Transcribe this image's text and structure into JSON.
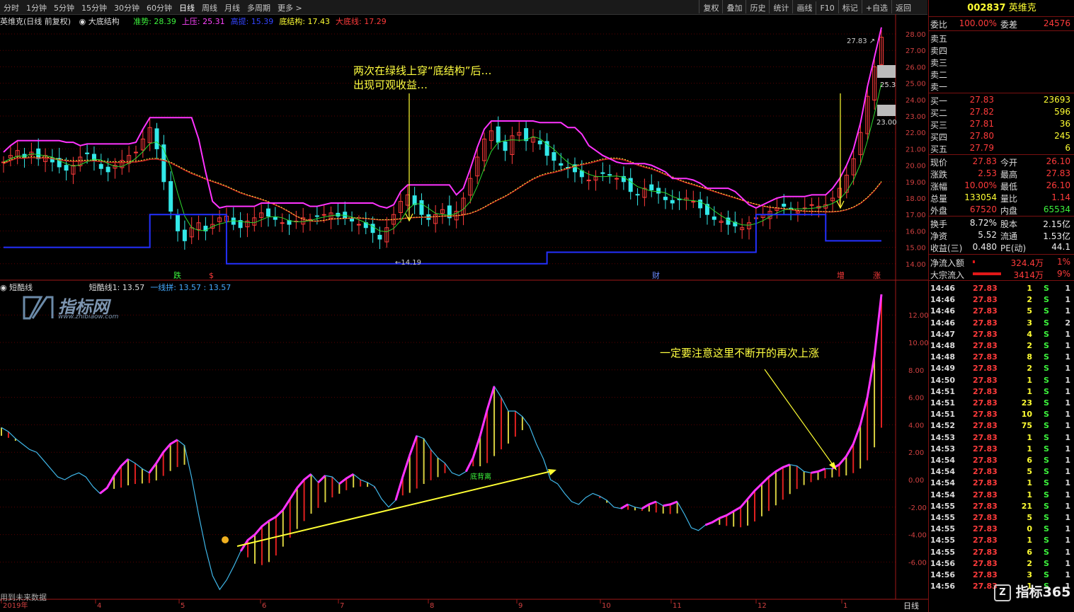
{
  "toolbar": {
    "left_items": [
      "分时",
      "1分钟",
      "5分钟",
      "15分钟",
      "30分钟",
      "60分钟",
      "日线",
      "周线",
      "月线",
      "多周期",
      "更多 >"
    ],
    "active": "日线",
    "right_items": [
      "复权",
      "叠加",
      "历史",
      "统计",
      "画线",
      "F10",
      "标记",
      "+自选",
      "返回"
    ]
  },
  "main_header": {
    "stock": "英维克(日线 前复权)",
    "indicator": "大底结构",
    "items": [
      {
        "label": "准势: 28.39",
        "color": "#3cf23c"
      },
      {
        "label": "上压: 25.31",
        "color": "#ff44ff"
      },
      {
        "label": "高提: 15.39",
        "color": "#3344ff"
      },
      {
        "label": "底结构: 17.43",
        "color": "#ffff33"
      },
      {
        "label": "大底线: 17.29",
        "color": "#ff3b3b"
      }
    ]
  },
  "ind_header": {
    "name": "短酷线",
    "items": [
      {
        "label": "短酷线1: 13.57",
        "color": "#dddddd"
      },
      {
        "label": "一线拼: 13.57 : 13.57",
        "color": "#44aaff"
      }
    ]
  },
  "annotations": {
    "top_line1": "两次在绿线上穿“底结构”后…",
    "top_line2": "出现可观收益…",
    "bottom": "一定要注意这里不断开的再次上涨",
    "divergence": "底背离",
    "low_price": "14.19",
    "high_price": "27.83",
    "marker_die": "跌",
    "marker_s": "$",
    "marker_cai": "财",
    "marker_zeng": "增",
    "marker_zhang": "涨"
  },
  "main_axis": {
    "ticks": [
      "28.00",
      "27.00",
      "26.00",
      "25.00",
      "24.00",
      "23.00",
      "22.00",
      "21.00",
      "20.00",
      "19.00",
      "18.00",
      "17.00",
      "16.00",
      "15.00",
      "14.00"
    ],
    "box1": "25.3",
    "box2": "23.00"
  },
  "ind_axis": {
    "ticks": [
      "12.00",
      "10.00",
      "8.00",
      "6.00",
      "4.00",
      "2.00",
      "0.00",
      "-2.00",
      "-4.00",
      "-6.00"
    ]
  },
  "date_axis": {
    "labels": [
      "2019年",
      "4",
      "5",
      "6",
      "7",
      "8",
      "9",
      "10",
      "11",
      "12",
      "1"
    ],
    "period": "日线"
  },
  "watermark": {
    "brand": "指标网",
    "url": "www.zhibiaow.com"
  },
  "bottom_note": "用到未来数据",
  "panel": {
    "title_code": "002837",
    "title_name": "英维克",
    "webi_label": "委比",
    "webi_value": "100.00%",
    "weicha_label": "委差",
    "weicha_value": "24576",
    "sells": [
      "卖五",
      "卖四",
      "卖三",
      "卖二",
      "卖一"
    ],
    "buys": [
      {
        "label": "买一",
        "price": "27.83",
        "vol": "23693"
      },
      {
        "label": "买二",
        "price": "27.82",
        "vol": "596"
      },
      {
        "label": "买三",
        "price": "27.81",
        "vol": "36"
      },
      {
        "label": "买四",
        "price": "27.80",
        "vol": "245"
      },
      {
        "label": "买五",
        "price": "27.79",
        "vol": "6"
      }
    ],
    "quote": [
      {
        "l": "现价",
        "v": "27.83",
        "vc": "red",
        "l2": "今开",
        "v2": "26.10",
        "v2c": "red"
      },
      {
        "l": "涨跌",
        "v": "2.53",
        "vc": "red",
        "l2": "最高",
        "v2": "27.83",
        "v2c": "red"
      },
      {
        "l": "涨幅",
        "v": "10.00%",
        "vc": "red",
        "l2": "最低",
        "v2": "26.10",
        "v2c": "red"
      },
      {
        "l": "总量",
        "v": "133054",
        "vc": "yellow",
        "l2": "量比",
        "v2": "1.14",
        "v2c": "red"
      },
      {
        "l": "外盘",
        "v": "67520",
        "vc": "red",
        "l2": "内盘",
        "v2": "65534",
        "v2c": "green"
      }
    ],
    "fund": [
      {
        "l": "换手",
        "v": "8.72%",
        "l2": "股本",
        "v2": "2.15亿"
      },
      {
        "l": "净资",
        "v": "5.52",
        "l2": "流通",
        "v2": "1.53亿"
      },
      {
        "l": "收益(三)",
        "v": "0.480",
        "l2": "PE(动)",
        "v2": "44.1"
      }
    ],
    "flow": [
      {
        "l": "净流入额",
        "v": "324.4万",
        "p": "1%"
      },
      {
        "l": "大宗流入",
        "v": "3414万",
        "p": "9%"
      }
    ],
    "ticks": [
      [
        "14:46",
        "27.83",
        "1",
        "S",
        "1"
      ],
      [
        "14:46",
        "27.83",
        "2",
        "S",
        "1"
      ],
      [
        "14:46",
        "27.83",
        "5",
        "S",
        "1"
      ],
      [
        "14:46",
        "27.83",
        "3",
        "S",
        "2"
      ],
      [
        "14:47",
        "27.83",
        "4",
        "S",
        "1"
      ],
      [
        "14:48",
        "27.83",
        "2",
        "S",
        "1"
      ],
      [
        "14:48",
        "27.83",
        "8",
        "S",
        "1"
      ],
      [
        "14:49",
        "27.83",
        "2",
        "S",
        "1"
      ],
      [
        "14:50",
        "27.83",
        "1",
        "S",
        "1"
      ],
      [
        "14:51",
        "27.83",
        "1",
        "S",
        "1"
      ],
      [
        "14:51",
        "27.83",
        "23",
        "S",
        "1"
      ],
      [
        "14:51",
        "27.83",
        "10",
        "S",
        "1"
      ],
      [
        "14:52",
        "27.83",
        "75",
        "S",
        "1"
      ],
      [
        "14:53",
        "27.83",
        "1",
        "S",
        "1"
      ],
      [
        "14:53",
        "27.83",
        "1",
        "S",
        "1"
      ],
      [
        "14:54",
        "27.83",
        "6",
        "S",
        "1"
      ],
      [
        "14:54",
        "27.83",
        "5",
        "S",
        "1"
      ],
      [
        "14:54",
        "27.83",
        "1",
        "S",
        "1"
      ],
      [
        "14:54",
        "27.83",
        "1",
        "S",
        "1"
      ],
      [
        "14:55",
        "27.83",
        "21",
        "S",
        "1"
      ],
      [
        "14:55",
        "27.83",
        "5",
        "S",
        "1"
      ],
      [
        "14:55",
        "27.83",
        "0",
        "S",
        "1"
      ],
      [
        "14:55",
        "27.83",
        "1",
        "S",
        "1"
      ],
      [
        "14:55",
        "27.83",
        "6",
        "S",
        "1"
      ],
      [
        "14:56",
        "27.83",
        "2",
        "S",
        "1"
      ],
      [
        "14:56",
        "27.83",
        "3",
        "S",
        "1"
      ],
      [
        "14:56",
        "27.83",
        "1",
        "S",
        "1"
      ]
    ],
    "logo": "指标365"
  }
}
